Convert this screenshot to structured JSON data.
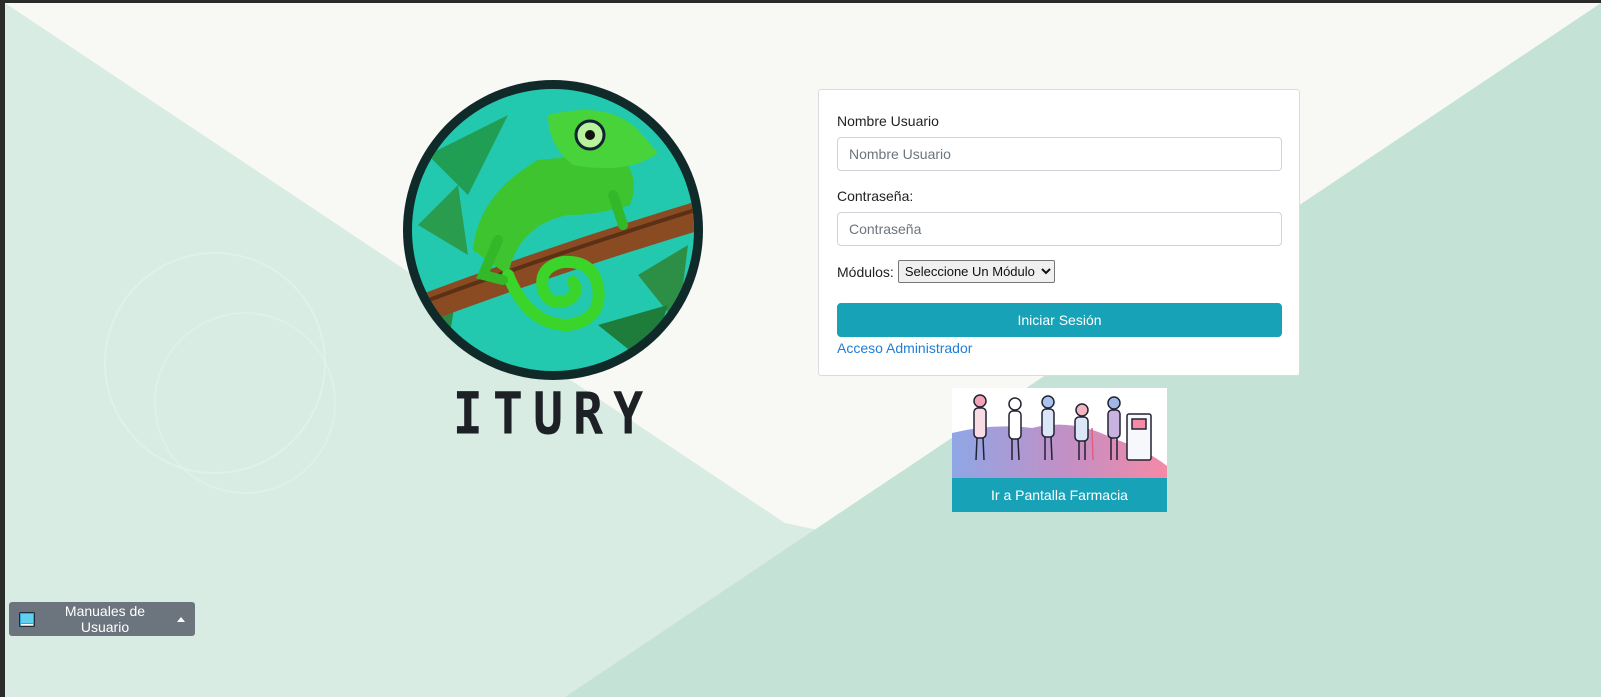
{
  "brand": {
    "name": "ITURY",
    "logo_icon": "chameleon-logo-icon"
  },
  "login": {
    "username_label": "Nombre Usuario",
    "username_placeholder": "Nombre Usuario",
    "username_value": "",
    "password_label": "Contraseña:",
    "password_placeholder": "Contraseña",
    "password_value": "",
    "modules_label": "Módulos:",
    "modules_selected": "Seleccione Un Módulo",
    "submit_label": "Iniciar Sesión",
    "admin_link": "Acceso Administrador"
  },
  "pharmacy": {
    "button_label": "Ir a Pantalla Farmacia",
    "illustration_icon": "queue-illustration-icon"
  },
  "manuals": {
    "label": "Manuales de Usuario",
    "icon": "book-icon"
  },
  "colors": {
    "primary": "#17a2b8",
    "link": "#1f7fd8",
    "secondary": "#6c757d",
    "background": "#f8f8f4",
    "bg_shape_light": "#d8ece4",
    "bg_shape_mid": "#c5e2d7"
  }
}
